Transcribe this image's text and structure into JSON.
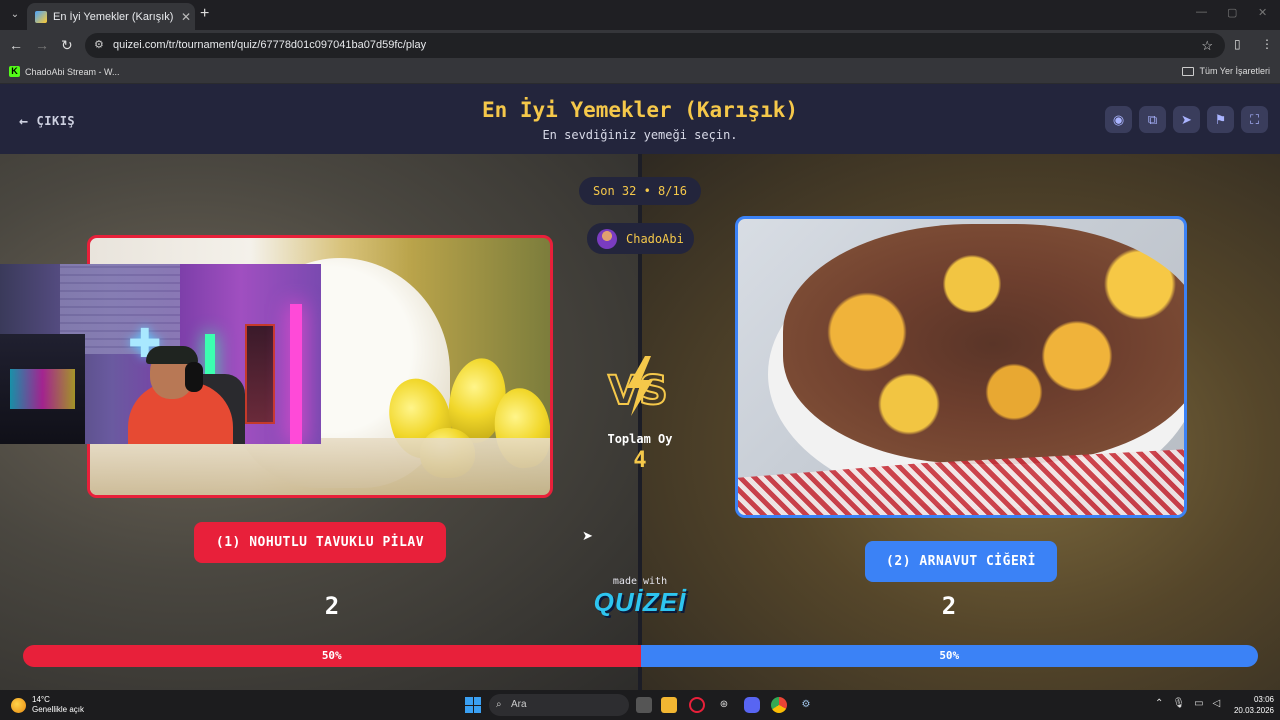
{
  "browser": {
    "tab_title": "En İyi Yemekler (Karışık) - Tier List, ...",
    "url": "quizei.com/tr/tournament/quiz/67778d01c097041ba07d59fc/play",
    "bookmark_left": "ChadoAbi Stream - W...",
    "bookmark_right": "Tüm Yer İşaretleri"
  },
  "header": {
    "exit_label": "ÇIKIŞ",
    "title": "En İyi Yemekler (Karışık)",
    "subtitle": "En sevdiğiniz yemeği seçin.",
    "icons": [
      "eye-icon",
      "share-icon",
      "send-icon",
      "flag-icon",
      "fullscreen-icon"
    ]
  },
  "round": {
    "label": "Son 32 • 8/16"
  },
  "user": {
    "name": "ChadoAbi"
  },
  "left": {
    "label": "(1) NOHUTLU TAVUKLU PİLAV",
    "votes": "2",
    "percent_label": "50%",
    "percent": 50,
    "color": "#e8203a"
  },
  "right": {
    "label": "(2) ARNAVUT CİĞERİ",
    "votes": "2",
    "percent_label": "50%",
    "percent": 50,
    "color": "#3b82f6"
  },
  "center": {
    "vs": "VS",
    "total_label": "Toplam Oy",
    "total_value": "4",
    "made_with": "made with",
    "brand": "QUİZEİ"
  },
  "taskbar": {
    "temp": "14°C",
    "weather": "Genellikle açık",
    "search_placeholder": "Ara",
    "time": "03:06",
    "date": "20.03.2026"
  }
}
